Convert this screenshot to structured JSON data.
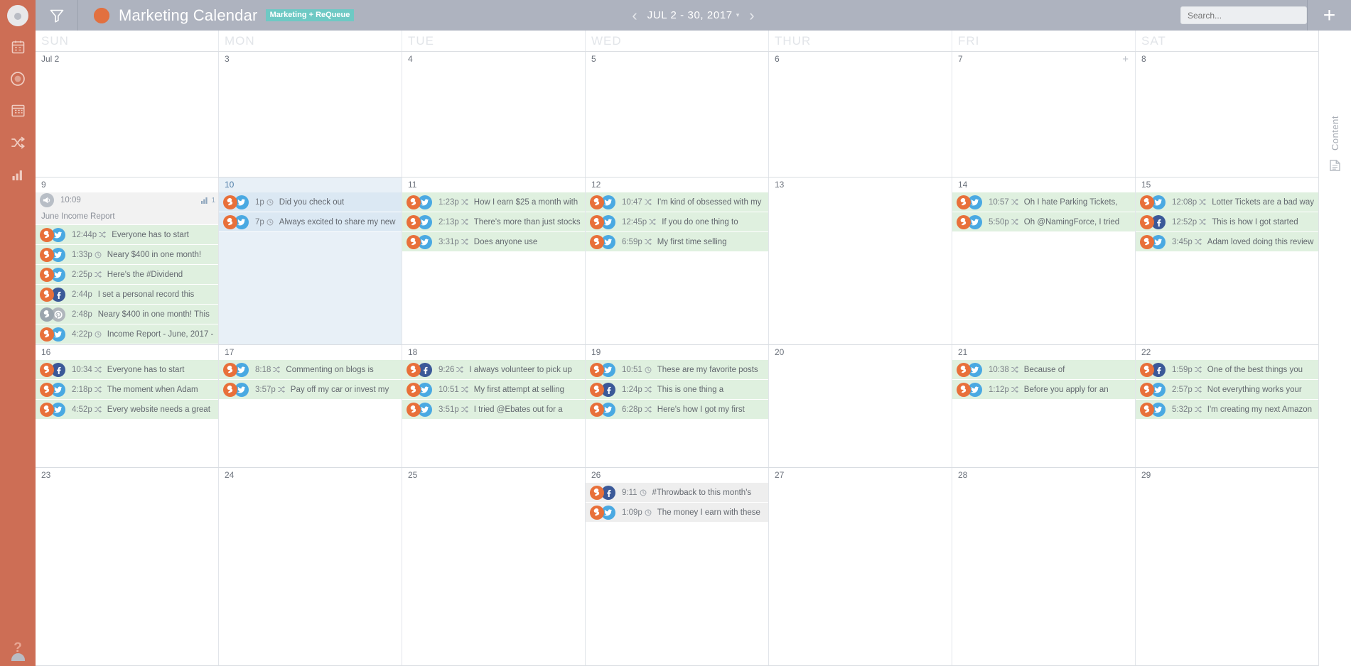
{
  "sidebar": {
    "avatar_name": "user-avatar",
    "items": [
      {
        "name": "calendar-clipboard",
        "label": "Calendar"
      },
      {
        "name": "requeue-circle",
        "label": "ReQueue"
      },
      {
        "name": "calendar-grid",
        "label": "Month"
      },
      {
        "name": "shuffle",
        "label": "Shuffle"
      },
      {
        "name": "analytics-bars",
        "label": "Analytics"
      }
    ],
    "help_label": "?"
  },
  "topbar": {
    "filter_label": "Filter",
    "title": "Marketing Calendar",
    "badge": "Marketing + ReQueue",
    "date_range": "JUL 2 - 30, 2017",
    "prev_label": "‹",
    "next_label": "›",
    "caret": "▾",
    "search_placeholder": "Search...",
    "search_value": "",
    "add_label": "+"
  },
  "right_rail": {
    "content_label": "Content"
  },
  "calendar": {
    "day_headers": [
      "SUN",
      "MON",
      "TUE",
      "WED",
      "THUR",
      "FRI",
      "SAT"
    ],
    "add_hint": "+",
    "weeks": [
      {
        "days": [
          {
            "num": "Jul 2",
            "today": false,
            "events": []
          },
          {
            "num": "3",
            "today": false,
            "events": []
          },
          {
            "num": "4",
            "today": false,
            "events": []
          },
          {
            "num": "5",
            "today": false,
            "events": []
          },
          {
            "num": "6",
            "today": false,
            "events": []
          },
          {
            "num": "7",
            "today": false,
            "plus": true,
            "events": []
          },
          {
            "num": "8",
            "today": false,
            "events": []
          }
        ]
      },
      {
        "days": [
          {
            "num": "9",
            "today": false,
            "report": {
              "time": "10:09",
              "stat": "1",
              "title": "June Income Report"
            },
            "events": [
              {
                "time": "12:44p",
                "mini": "shuffle",
                "text": "Everyone has to start",
                "net": "twitter",
                "tone": "green"
              },
              {
                "time": "1:33p",
                "mini": "clock",
                "text": "Neary $400 in one month!",
                "net": "twitter",
                "tone": "green"
              },
              {
                "time": "2:25p",
                "mini": "shuffle",
                "text": "Here's the #Dividend",
                "net": "twitter",
                "tone": "green"
              },
              {
                "time": "2:44p",
                "mini": "",
                "text": "I set a personal record this",
                "net": "facebook",
                "tone": "green"
              },
              {
                "time": "2:48p",
                "mini": "",
                "text": "Neary $400 in one month! This",
                "net": "pinterest",
                "tone": "green",
                "muted": true
              },
              {
                "time": "4:22p",
                "mini": "clock",
                "text": "Income Report - June, 2017 -",
                "net": "twitter",
                "tone": "green"
              }
            ]
          },
          {
            "num": "10",
            "today": true,
            "events": [
              {
                "time": "1p",
                "mini": "clock",
                "text": "Did you check out",
                "net": "twitter",
                "tone": "blue"
              },
              {
                "time": "7p",
                "mini": "clock",
                "text": "Always excited to share my new",
                "net": "twitter",
                "tone": "blue"
              }
            ]
          },
          {
            "num": "11",
            "today": false,
            "events": [
              {
                "time": "1:23p",
                "mini": "shuffle",
                "text": "How I earn $25 a month with",
                "net": "twitter",
                "tone": "green"
              },
              {
                "time": "2:13p",
                "mini": "shuffle",
                "text": "There's more than just stocks",
                "net": "twitter",
                "tone": "green"
              },
              {
                "time": "3:31p",
                "mini": "shuffle",
                "text": "Does anyone use",
                "net": "twitter",
                "tone": "green"
              }
            ]
          },
          {
            "num": "12",
            "today": false,
            "events": [
              {
                "time": "10:47",
                "mini": "shuffle",
                "text": "I'm kind of obsessed with my",
                "net": "twitter",
                "tone": "green"
              },
              {
                "time": "12:45p",
                "mini": "shuffle",
                "text": "If you do one thing to",
                "net": "twitter",
                "tone": "green"
              },
              {
                "time": "6:59p",
                "mini": "shuffle",
                "text": "My first time selling",
                "net": "twitter",
                "tone": "green"
              }
            ]
          },
          {
            "num": "13",
            "today": false,
            "events": []
          },
          {
            "num": "14",
            "today": false,
            "events": [
              {
                "time": "10:57",
                "mini": "shuffle",
                "text": "Oh I hate Parking Tickets,",
                "net": "twitter",
                "tone": "green"
              },
              {
                "time": "5:50p",
                "mini": "shuffle",
                "text": "Oh @NamingForce, I tried",
                "net": "twitter",
                "tone": "green"
              }
            ]
          },
          {
            "num": "15",
            "today": false,
            "events": [
              {
                "time": "12:08p",
                "mini": "shuffle",
                "text": "Lotter Tickets are a bad way",
                "net": "twitter",
                "tone": "green"
              },
              {
                "time": "12:52p",
                "mini": "shuffle",
                "text": "This is how I got started",
                "net": "facebook",
                "tone": "green"
              },
              {
                "time": "3:45p",
                "mini": "shuffle",
                "text": "Adam loved doing this review",
                "net": "twitter",
                "tone": "green"
              }
            ]
          }
        ]
      },
      {
        "days": [
          {
            "num": "16",
            "today": false,
            "events": [
              {
                "time": "10:34",
                "mini": "shuffle",
                "text": "Everyone has to start",
                "net": "facebook",
                "tone": "green"
              },
              {
                "time": "2:18p",
                "mini": "shuffle",
                "text": "The moment when Adam",
                "net": "twitter",
                "tone": "green"
              },
              {
                "time": "4:52p",
                "mini": "shuffle",
                "text": "Every website needs a great",
                "net": "twitter",
                "tone": "green"
              }
            ]
          },
          {
            "num": "17",
            "today": false,
            "events": [
              {
                "time": "8:18",
                "mini": "shuffle",
                "text": "Commenting on blogs is",
                "net": "twitter",
                "tone": "green"
              },
              {
                "time": "3:57p",
                "mini": "shuffle",
                "text": "Pay off my car or invest my",
                "net": "twitter",
                "tone": "green"
              }
            ]
          },
          {
            "num": "18",
            "today": false,
            "events": [
              {
                "time": "9:26",
                "mini": "shuffle",
                "text": "I always volunteer to pick up",
                "net": "facebook",
                "tone": "green"
              },
              {
                "time": "10:51",
                "mini": "shuffle",
                "text": "My first attempt at selling",
                "net": "twitter",
                "tone": "green"
              },
              {
                "time": "3:51p",
                "mini": "shuffle",
                "text": "I tried @Ebates out for a",
                "net": "twitter",
                "tone": "green"
              }
            ]
          },
          {
            "num": "19",
            "today": false,
            "events": [
              {
                "time": "10:51",
                "mini": "clock",
                "text": "These are my favorite posts",
                "net": "twitter",
                "tone": "green"
              },
              {
                "time": "1:24p",
                "mini": "shuffle",
                "text": "This is one thing a",
                "net": "facebook",
                "tone": "green"
              },
              {
                "time": "6:28p",
                "mini": "shuffle",
                "text": "Here's how I got my first",
                "net": "twitter",
                "tone": "green"
              }
            ]
          },
          {
            "num": "20",
            "today": false,
            "events": []
          },
          {
            "num": "21",
            "today": false,
            "events": [
              {
                "time": "10:38",
                "mini": "shuffle",
                "text": "Because of",
                "net": "twitter",
                "tone": "green"
              },
              {
                "time": "1:12p",
                "mini": "shuffle",
                "text": "Before you apply for an",
                "net": "twitter",
                "tone": "green"
              }
            ]
          },
          {
            "num": "22",
            "today": false,
            "events": [
              {
                "time": "1:59p",
                "mini": "shuffle",
                "text": "One of the best things you",
                "net": "facebook",
                "tone": "green"
              },
              {
                "time": "2:57p",
                "mini": "shuffle",
                "text": "Not everything works your",
                "net": "twitter",
                "tone": "green"
              },
              {
                "time": "5:32p",
                "mini": "shuffle",
                "text": "I'm creating my next Amazon",
                "net": "twitter",
                "tone": "green"
              }
            ]
          }
        ]
      },
      {
        "days": [
          {
            "num": "23",
            "today": false,
            "events": []
          },
          {
            "num": "24",
            "today": false,
            "events": []
          },
          {
            "num": "25",
            "today": false,
            "events": []
          },
          {
            "num": "26",
            "today": false,
            "events": [
              {
                "time": "9:11",
                "mini": "clock",
                "text": "#Throwback to this month's",
                "net": "facebook",
                "tone": "gray"
              },
              {
                "time": "1:09p",
                "mini": "clock",
                "text": "The money I earn with these",
                "net": "twitter",
                "tone": "gray"
              }
            ]
          },
          {
            "num": "27",
            "today": false,
            "events": []
          },
          {
            "num": "28",
            "today": false,
            "events": []
          },
          {
            "num": "29",
            "today": false,
            "events": []
          }
        ]
      }
    ]
  }
}
